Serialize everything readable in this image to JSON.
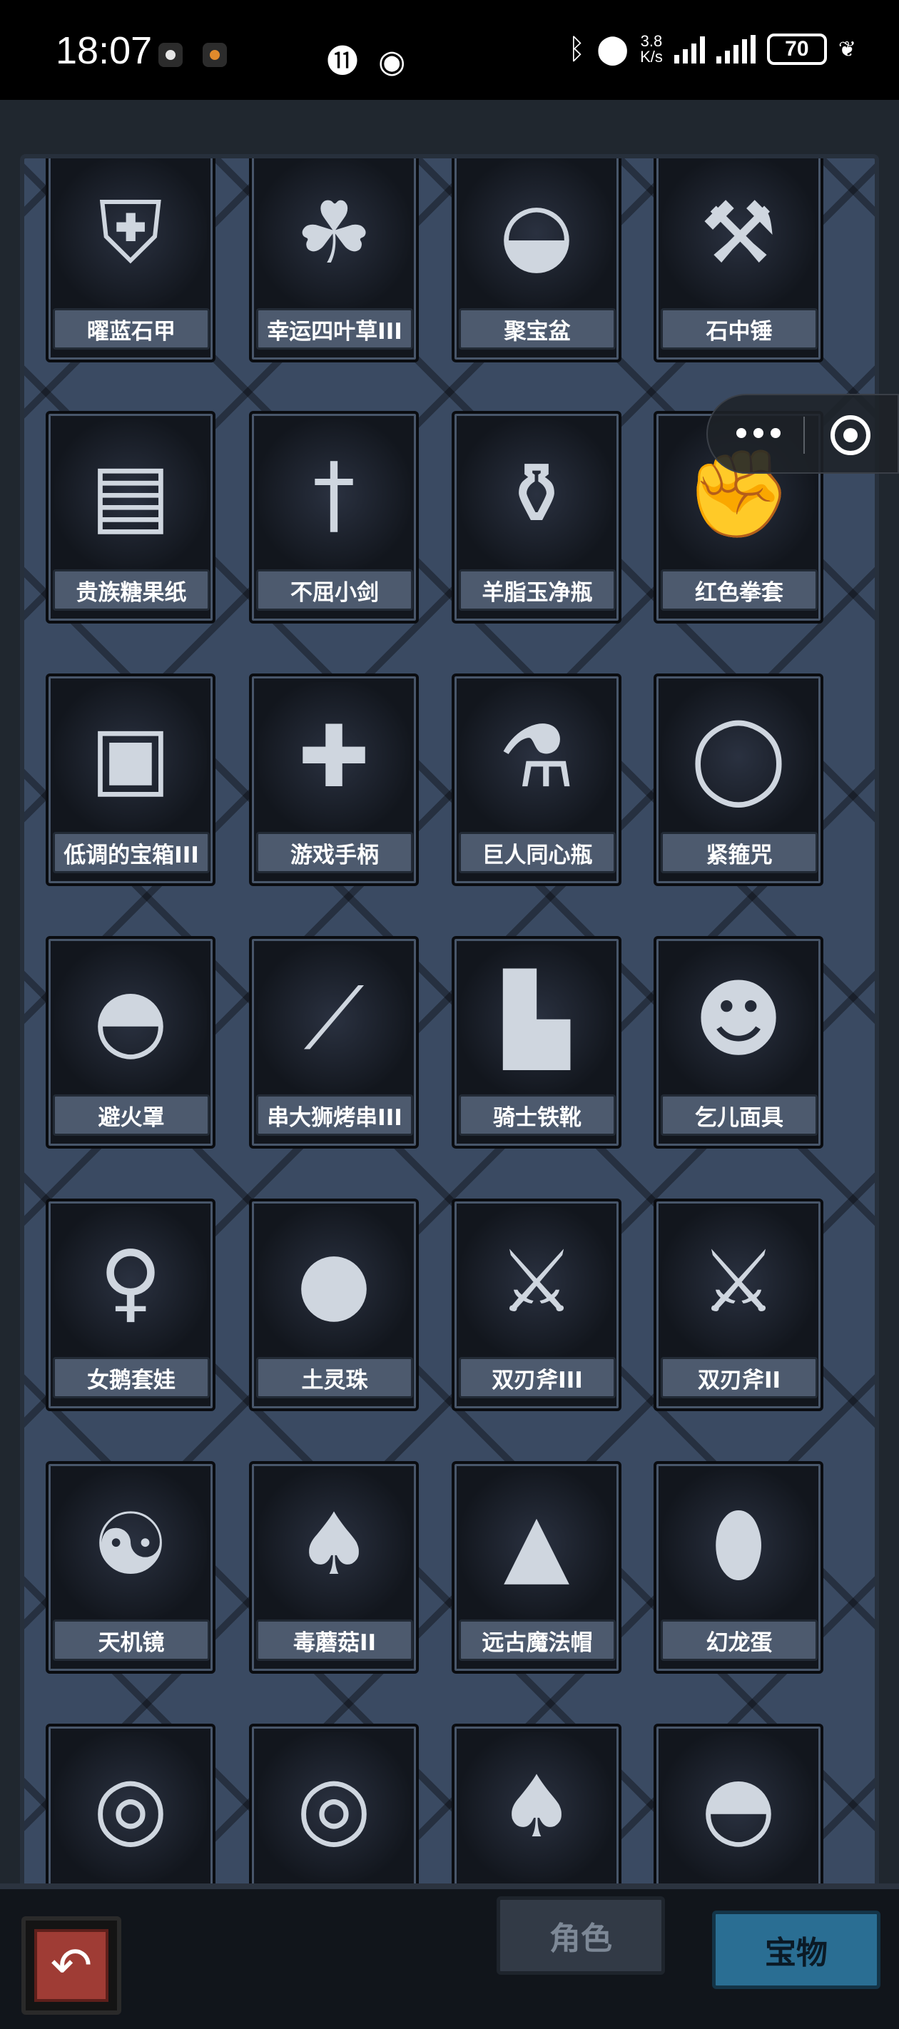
{
  "status_bar": {
    "time": "18:07",
    "net_speed_top": "3.8",
    "net_speed_bottom": "K/s",
    "battery": "70"
  },
  "items": [
    {
      "label": "曜蓝石甲",
      "icon": "armor-icon"
    },
    {
      "label": "幸运四叶草III",
      "icon": "clover-icon"
    },
    {
      "label": "聚宝盆",
      "icon": "gold-bowl-icon"
    },
    {
      "label": "石中锤",
      "icon": "hammer-icon"
    },
    {
      "label": "贵族糖果纸",
      "icon": "candy-paper-icon"
    },
    {
      "label": "不屈小剑",
      "icon": "short-sword-icon"
    },
    {
      "label": "羊脂玉净瓶",
      "icon": "jade-vase-icon"
    },
    {
      "label": "红色拳套",
      "icon": "boxing-glove-icon"
    },
    {
      "label": "低调的宝箱III",
      "icon": "treasure-chest-icon"
    },
    {
      "label": "游戏手柄",
      "icon": "gamepad-icon"
    },
    {
      "label": "巨人同心瓶",
      "icon": "jar-icon"
    },
    {
      "label": "紧箍咒",
      "icon": "golden-band-icon"
    },
    {
      "label": "避火罩",
      "icon": "fire-hood-icon"
    },
    {
      "label": "串大狮烤串III",
      "icon": "skewer-icon"
    },
    {
      "label": "骑士铁靴",
      "icon": "iron-boots-icon"
    },
    {
      "label": "乞儿面具",
      "icon": "beggar-mask-icon"
    },
    {
      "label": "女鹅套娃",
      "icon": "nesting-doll-icon"
    },
    {
      "label": "土灵珠",
      "icon": "earth-orb-icon"
    },
    {
      "label": "双刃斧III",
      "icon": "double-axe-icon"
    },
    {
      "label": "双刃斧II",
      "icon": "double-axe-icon"
    },
    {
      "label": "天机镜",
      "icon": "bagua-mirror-icon"
    },
    {
      "label": "毒蘑菇II",
      "icon": "mushroom-icon"
    },
    {
      "label": "远古魔法帽",
      "icon": "wizard-hat-icon"
    },
    {
      "label": "幻龙蛋",
      "icon": "dragon-egg-icon"
    },
    {
      "label": "",
      "icon": "golden-ring-icon"
    },
    {
      "label": "",
      "icon": "donut-icon"
    },
    {
      "label": "",
      "icon": "mushroom-icon"
    },
    {
      "label": "",
      "icon": "sunglasses-icon"
    }
  ],
  "bottom_bar": {
    "tab_role": "角色",
    "tab_treasure": "宝物"
  },
  "colors": {
    "frame": "#3a4a62",
    "label_bg": "#4d5a6e",
    "back_button": "#9f3c35",
    "active_tab": "#2a6e93"
  }
}
